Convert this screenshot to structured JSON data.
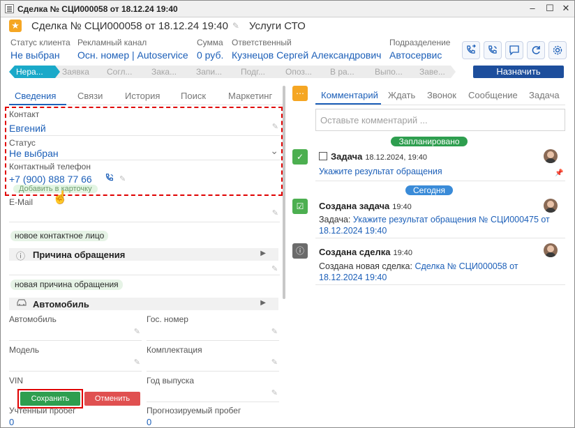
{
  "window": {
    "title": "Сделка № СЦИ000058 от 18.12.24 19:40",
    "min": "–",
    "max": "☐",
    "close": "✕"
  },
  "deal": {
    "title": "Сделка № СЦИ000058 от 18.12.24 19:40",
    "type": "Услуги СТО"
  },
  "meta": [
    {
      "label": "Статус клиента",
      "value": "Не выбран"
    },
    {
      "label": "Рекламный канал",
      "value": "Осн. номер | Autoservice"
    },
    {
      "label": "Сумма",
      "value": "0 руб."
    },
    {
      "label": "Ответственный",
      "value": "Кузнецов Сергей Александрович"
    },
    {
      "label": "Подразделение",
      "value": "Автосервис"
    }
  ],
  "stages": [
    "Нера...",
    "Заявка",
    "Согл...",
    "Зака...",
    "Запи...",
    "Подг...",
    "Опоз...",
    "В ра...",
    "Выпо...",
    "Заве..."
  ],
  "assign_label": "Назначить",
  "left_tabs": [
    "Сведения",
    "Связи",
    "История",
    "Поиск",
    "Маркетинг"
  ],
  "contact": {
    "label": "Контакт",
    "value": "Евгений"
  },
  "status": {
    "label": "Статус",
    "value": "Не выбран"
  },
  "phone": {
    "label": "Контактный телефон",
    "value": "+7 (900) 888 77 66",
    "add_to_card": "Добавить в карточку"
  },
  "email": {
    "label": "E-Mail",
    "value": ""
  },
  "chips": {
    "new_contact": "новое контактное лицо",
    "new_reason": "новая причина обращения"
  },
  "sections": {
    "reason": "Причина обращения",
    "car": "Автомобиль"
  },
  "car_fields": {
    "car": "Автомобиль",
    "plate": "Гос. номер",
    "model": "Модель",
    "trim": "Комплектация",
    "vin": "VIN",
    "year": "Год выпуска",
    "mileage": "Учтенный пробег",
    "mileage_value": "0",
    "forecast": "Прогнозируемый пробег",
    "forecast_value": "0"
  },
  "buttons": {
    "save": "Сохранить",
    "cancel": "Отменить"
  },
  "right_tabs": [
    "Комментарий",
    "Ждать",
    "Звонок",
    "Сообщение",
    "Задача"
  ],
  "comment_placeholder": "Оставьте комментарий ...",
  "timeline": {
    "planned_label": "Запланировано",
    "today_label": "Сегодня",
    "task": {
      "title": "Задача",
      "time": "18.12.2024, 19:40",
      "link": "Укажите результат обращения"
    },
    "created_task": {
      "title": "Создана задача",
      "time": "19:40",
      "prefix": "Задача:",
      "link": "Укажите результат обращения № СЦИ000475 от 18.12.2024 19:40"
    },
    "created_deal": {
      "title": "Создана сделка",
      "time": "19:40",
      "prefix": "Создана новая сделка:",
      "link": "Сделка № СЦИ000058 от 18.12.2024 19:40"
    }
  },
  "colors": {
    "accent": "#1c5fb8",
    "stage_active": "#1aa9c9",
    "assign": "#1d4e9c",
    "save": "#2e9e4f",
    "cancel": "#e05050",
    "planned": "#2e9e4f",
    "today": "#3a8bd8",
    "highlight": "#e00000"
  }
}
